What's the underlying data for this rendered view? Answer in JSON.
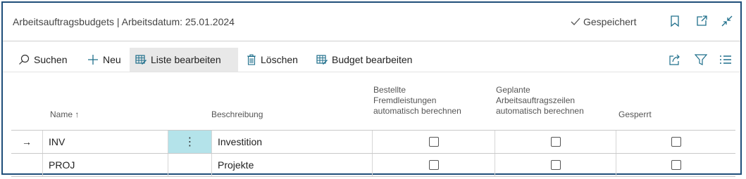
{
  "header": {
    "title": "Arbeitsauftragsbudgets | Arbeitsdatum: 25.01.2024",
    "saved_label": "Gespeichert",
    "icons": [
      "bookmark-icon",
      "open-new-window-icon",
      "collapse-icon"
    ]
  },
  "toolbar": {
    "search_label": "Suchen",
    "new_label": "Neu",
    "edit_list_label": "Liste bearbeiten",
    "delete_label": "Löschen",
    "edit_budget_label": "Budget bearbeiten",
    "right_icons": [
      "share-icon",
      "filter-icon",
      "list-view-icon"
    ]
  },
  "table": {
    "columns": {
      "name": "Name ↑",
      "description": "Beschreibung",
      "ordered_line1": "Bestellte",
      "ordered_line2": "Fremdleistungen",
      "ordered_line3": "automatisch berechnen",
      "planned_line1": "Geplante",
      "planned_line2": "Arbeitsauftragszeilen",
      "planned_line3": "automatisch berechnen",
      "blocked": "Gesperrt"
    },
    "rows": [
      {
        "indicator": "→",
        "name": "INV",
        "menu": "⋮",
        "description": "Investition",
        "ordered": false,
        "planned": false,
        "blocked": false
      },
      {
        "indicator": "",
        "name": "PROJ",
        "menu": "",
        "description": "Projekte",
        "ordered": false,
        "planned": false,
        "blocked": false
      }
    ]
  },
  "colors": {
    "frame": "#1f4e79",
    "selected_cell": "#b4e3ea",
    "active_button": "#e8e8e8"
  }
}
